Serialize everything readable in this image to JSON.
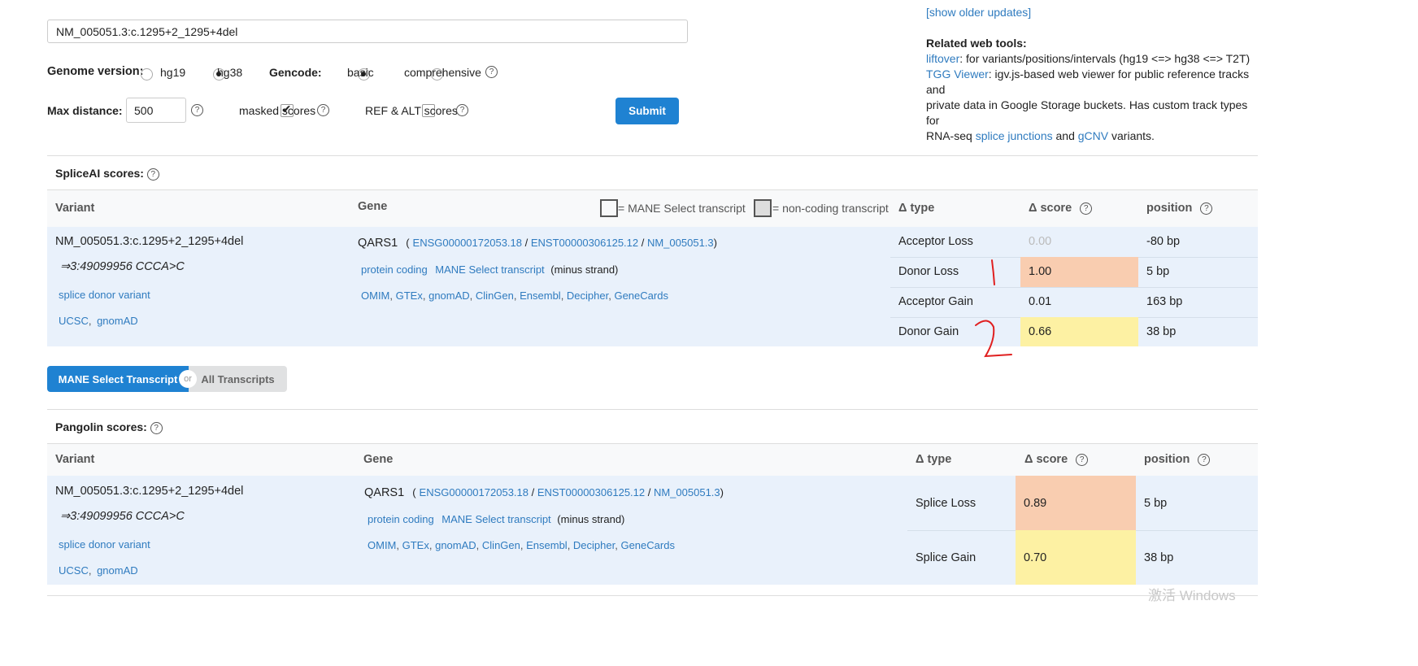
{
  "form": {
    "variant_value": "NM_005051.3:c.1295+2_1295+4del",
    "genome_label": "Genome version:",
    "genome_options": [
      "hg19",
      "hg38"
    ],
    "genome_selected": "hg38",
    "gencode_label": "Gencode:",
    "gencode_options": [
      "basic",
      "comprehensive"
    ],
    "gencode_selected": "basic",
    "max_distance_label": "Max distance:",
    "max_distance_value": "500",
    "masked_label": "masked scores",
    "masked_checked": true,
    "refalt_label": "REF & ALT scores",
    "refalt_checked": false,
    "submit_label": "Submit"
  },
  "sidebar": {
    "older_updates": "[show older updates]",
    "related_title": "Related web tools:",
    "liftover_link": "liftover",
    "liftover_desc": ": for variants/positions/intervals (hg19 <=> hg38 <=> T2T)",
    "tgg_link": "TGG Viewer",
    "tgg_desc1": ": igv.js-based web viewer for public reference tracks and",
    "tgg_desc2": "private data in Google Storage buckets. Has custom track types for",
    "tgg_desc3": "RNA-seq ",
    "splice_link": "splice junctions",
    "and_text": " and ",
    "gcnv_link": "gCNV",
    "variants_text": " variants."
  },
  "spliceai": {
    "title": "SpliceAI scores:",
    "col_variant": "Variant",
    "col_gene": "Gene",
    "mane_legend": "= MANE Select transcript",
    "noncoding_legend": "= non-coding transcript",
    "col_type": "Δ type",
    "col_score": "Δ score",
    "col_position": "position",
    "variant": "NM_005051.3:c.1295+2_1295+4del",
    "variant_converted": "⇒3:49099956 CCCA>C",
    "consequence": "splice donor variant",
    "variant_links": [
      "UCSC",
      "gnomAD"
    ],
    "gene_name": "QARS1",
    "gene_id": "ENSG00000172053.18",
    "transcript_id": "ENST00000306125.12",
    "refseq_id": "NM_005051.3",
    "biotype": "protein coding",
    "mane_tag": "MANE Select transcript",
    "strand": "(minus strand)",
    "gene_links": [
      "OMIM",
      "GTEx",
      "gnomAD",
      "ClinGen",
      "Ensembl",
      "Decipher",
      "GeneCards"
    ],
    "rows": [
      {
        "type": "Acceptor Loss",
        "score": "0.00",
        "position": "-80 bp",
        "color": "none"
      },
      {
        "type": "Donor Loss",
        "score": "1.00",
        "position": "5 bp",
        "color": "#f9cdb0"
      },
      {
        "type": "Acceptor Gain",
        "score": "0.01",
        "position": "163 bp",
        "color": "none"
      },
      {
        "type": "Donor Gain",
        "score": "0.66",
        "position": "38 bp",
        "color": "#fdf1a3"
      }
    ]
  },
  "toggle": {
    "mane": "MANE Select Transcript",
    "or": "or",
    "all": "All Transcripts"
  },
  "pangolin": {
    "title": "Pangolin scores:",
    "col_variant": "Variant",
    "col_gene": "Gene",
    "col_type": "Δ type",
    "col_score": "Δ score",
    "col_position": "position",
    "variant": "NM_005051.3:c.1295+2_1295+4del",
    "variant_converted": "⇒3:49099956 CCCA>C",
    "consequence": "splice donor variant",
    "variant_links": [
      "UCSC",
      "gnomAD"
    ],
    "gene_name": "QARS1",
    "gene_id": "ENSG00000172053.18",
    "transcript_id": "ENST00000306125.12",
    "refseq_id": "NM_005051.3",
    "biotype": "protein coding",
    "mane_tag": "MANE Select transcript",
    "strand": "(minus strand)",
    "gene_links": [
      "OMIM",
      "GTEx",
      "gnomAD",
      "ClinGen",
      "Ensembl",
      "Decipher",
      "GeneCards"
    ],
    "rows": [
      {
        "type": "Splice Loss",
        "score": "0.89",
        "position": "5 bp",
        "color": "#f9cdb0"
      },
      {
        "type": "Splice Gain",
        "score": "0.70",
        "position": "38 bp",
        "color": "#fdf1a3"
      }
    ]
  },
  "watermark": "激活 Windows"
}
